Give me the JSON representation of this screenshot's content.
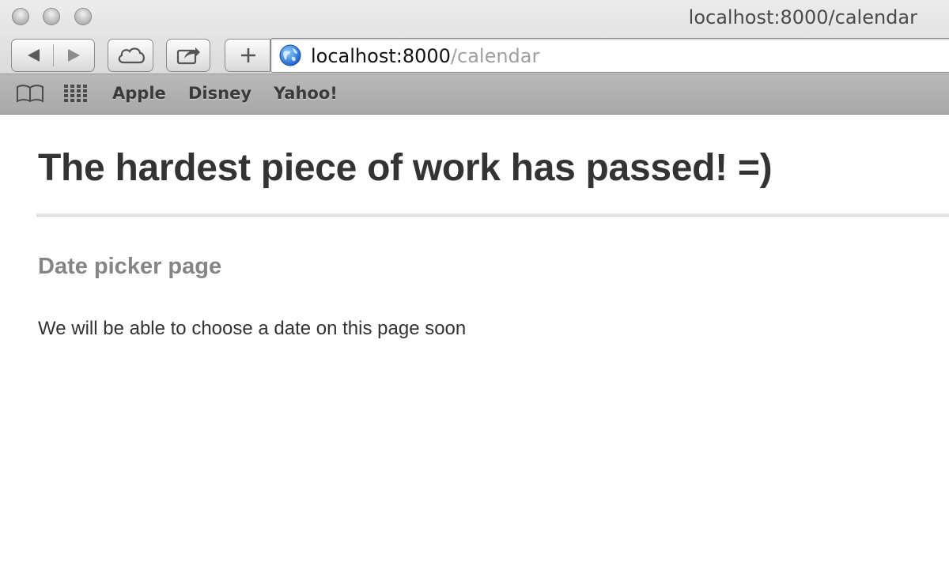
{
  "window": {
    "title": "localhost:8000/calendar"
  },
  "toolbar": {
    "back_icon": "back-arrow-icon",
    "forward_icon": "forward-arrow-icon",
    "icloud_icon": "cloud-icon",
    "share_icon": "share-icon",
    "new_tab_icon": "plus-icon"
  },
  "address_bar": {
    "host": "localhost:8000",
    "path": "/calendar",
    "icon": "globe-icon"
  },
  "bookmarks": {
    "reading_list_icon": "open-book-icon",
    "top_sites_icon": "grid-icon",
    "items": [
      {
        "label": "Apple"
      },
      {
        "label": "Disney"
      },
      {
        "label": "Yahoo!"
      }
    ]
  },
  "page": {
    "title": "The hardest piece of work has passed! =)",
    "subtitle": "Date picker page",
    "body": "We will be able to choose a date on this page soon"
  },
  "colors": {
    "heading": "#333333",
    "subtitle": "#858585",
    "url_path": "#a0a0a0"
  }
}
